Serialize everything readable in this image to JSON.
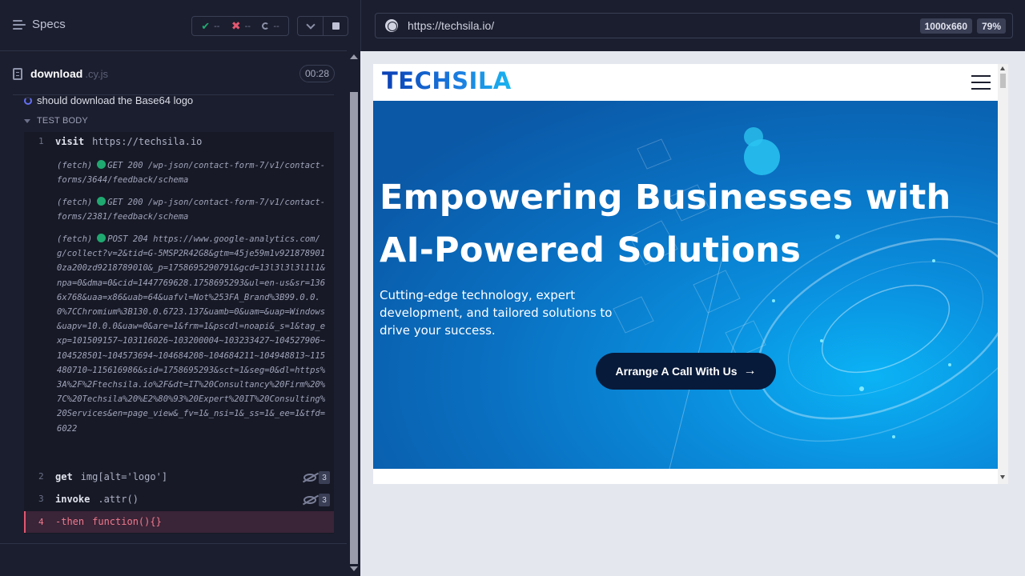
{
  "reporter": {
    "specs_label": "Specs",
    "stats": {
      "passed": "--",
      "failed": "--",
      "pending": "--"
    },
    "spec": {
      "name": "download",
      "ext": ".cy.js",
      "duration": "00:28"
    },
    "test": {
      "title": "should download the Base64 logo",
      "body_label": "TEST BODY"
    },
    "commands": [
      {
        "num": "1",
        "name": "visit",
        "arg": "https://techsila.io"
      },
      {
        "num": "2",
        "name": "get",
        "arg": "img[alt='logo']",
        "count": "3"
      },
      {
        "num": "3",
        "name": "invoke",
        "arg": ".attr()",
        "count": "3"
      },
      {
        "num": "4",
        "name": "-then",
        "arg": "function(){}"
      }
    ],
    "logs": [
      {
        "prefix": "(fetch)",
        "text": "GET 200 /wp-json/contact-form-7/v1/contact-forms/3644/feedback/schema"
      },
      {
        "prefix": "(fetch)",
        "text": "GET 200 /wp-json/contact-form-7/v1/contact-forms/2381/feedback/schema"
      },
      {
        "prefix": "(fetch)",
        "text": "POST 204 https://www.google-analytics.com/g/collect?v=2&tid=G-5MSP2R42G8&gtm=45je59m1v9218789010za200zd9218789010&_p=1758695290791&gcd=13l3l3l3l1l1&npa=0&dma=0&cid=1447769628.1758695293&ul=en-us&sr=1366x768&uaa=x86&uab=64&uafvl=Not%253FA_Brand%3B99.0.0.0%7CChromium%3B130.0.6723.137&uamb=0&uam=&uap=Windows&uapv=10.0.0&uaw=0&are=1&frm=1&pscdl=noapi&_s=1&tag_exp=101509157~103116026~103200004~103233427~104527906~104528501~104573694~104684208~104684211~104948813~115480710~115616986&sid=1758695293&sct=1&seg=0&dl=https%3A%2F%2Ftechsila.io%2F&dt=IT%20Consultancy%20Firm%20%7C%20Techsila%20%E2%80%93%20Expert%20IT%20Consulting%20Services&en=page_view&_fv=1&_nsi=1&_ss=1&_ee=1&tfd=6022"
      }
    ]
  },
  "aut": {
    "url": "https://techsila.io/",
    "viewport": "1000x660",
    "zoom": "79%"
  },
  "site": {
    "logo": "TECHSILA",
    "hero_title": "Empowering Businesses with AI-Powered Solutions",
    "hero_subtitle": "Cutting-edge technology, expert development, and tailored solutions to drive your success.",
    "cta_label": "Arrange A Call With Us",
    "cta_arrow": "→"
  },
  "colors": {
    "reporter_bg": "#1b1e2e",
    "passed": "#1fa971",
    "failed": "#e45770",
    "hero_blue": "#0a6fc0",
    "cta_bg": "#081a3a"
  }
}
